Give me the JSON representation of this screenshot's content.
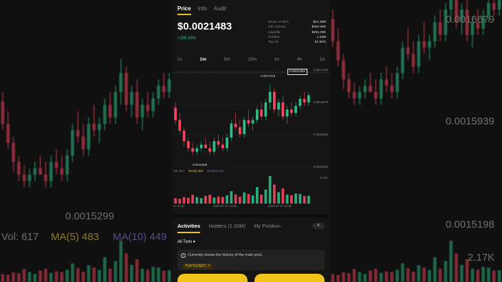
{
  "tabs": [
    "Price",
    "Info",
    "Audit"
  ],
  "price": "$0.0021483",
  "change": "+156.39%",
  "stats": [
    {
      "label": "MCap on BSC",
      "value": "$21.48M"
    },
    {
      "label": "24h Volume",
      "value": "$322.59K"
    },
    {
      "label": "Liquidity",
      "value": "$251.05K"
    },
    {
      "label": "Holders",
      "value": "1.33M"
    },
    {
      "label": "Top 10",
      "value": "51.92%"
    }
  ],
  "timeframes": [
    "1s",
    "1m",
    "5m",
    "15m",
    "1h",
    "4h",
    "1d"
  ],
  "selected_timeframe": "1m",
  "chart": {
    "axis_top": "0.0017403",
    "axis_mid_upper": "0.0016679",
    "axis_mid": "0.0015939",
    "axis_low": "0.0015198",
    "current_price_tag": "0.0021483",
    "high_label": "0.0017319",
    "low_label": "0.0015299",
    "vol_axis": "2.17K",
    "vol_label": "Vol: 617",
    "ma5_label": "MA(5) 483",
    "ma10_label": "MA(10) 449",
    "time_1": "17 10:31",
    "time_2": "2025-07-17 12:36",
    "time_3": "2025-07-17 12:36",
    "colors": {
      "up": "#2ebd85",
      "down": "#f6465d",
      "accent": "#f0c419"
    }
  },
  "chart_data": {
    "type": "candlestick",
    "ohlc": [
      [
        0.001665,
        0.00168,
        0.00162,
        0.00163
      ],
      [
        0.00163,
        0.00165,
        0.00159,
        0.0016
      ],
      [
        0.0016,
        0.00161,
        0.001555,
        0.00157
      ],
      [
        0.00157,
        0.00158,
        0.00154,
        0.00155
      ],
      [
        0.00155,
        0.001565,
        0.00153,
        0.00154
      ],
      [
        0.00154,
        0.00156,
        0.0015299,
        0.00155
      ],
      [
        0.00155,
        0.00157,
        0.00154,
        0.00156
      ],
      [
        0.00156,
        0.00158,
        0.00155,
        0.00155
      ],
      [
        0.00155,
        0.00157,
        0.00153,
        0.00154
      ],
      [
        0.00154,
        0.00158,
        0.00153,
        0.00157
      ],
      [
        0.00157,
        0.00159,
        0.00155,
        0.00156
      ],
      [
        0.00156,
        0.00158,
        0.00154,
        0.00155
      ],
      [
        0.00155,
        0.00159,
        0.00154,
        0.00158
      ],
      [
        0.00158,
        0.00163,
        0.00157,
        0.00162
      ],
      [
        0.00162,
        0.00165,
        0.0016,
        0.00161
      ],
      [
        0.00161,
        0.00163,
        0.00158,
        0.00159
      ],
      [
        0.00159,
        0.00164,
        0.00158,
        0.00163
      ],
      [
        0.00163,
        0.00166,
        0.00161,
        0.00162
      ],
      [
        0.00162,
        0.00164,
        0.0016,
        0.00163
      ],
      [
        0.00163,
        0.00167,
        0.00162,
        0.00166
      ],
      [
        0.00166,
        0.00168,
        0.00163,
        0.00164
      ],
      [
        0.00164,
        0.00169,
        0.00163,
        0.00168
      ],
      [
        0.00168,
        0.0017319,
        0.00166,
        0.00171
      ],
      [
        0.00171,
        0.00172,
        0.00165,
        0.00166
      ],
      [
        0.00166,
        0.00169,
        0.00164,
        0.00168
      ],
      [
        0.00168,
        0.0017,
        0.00163,
        0.00164
      ],
      [
        0.00164,
        0.00167,
        0.00162,
        0.00166
      ],
      [
        0.00166,
        0.00168,
        0.00164,
        0.00165
      ],
      [
        0.00165,
        0.00168,
        0.00164,
        0.00167
      ],
      [
        0.00167,
        0.0017,
        0.00166,
        0.00169
      ],
      [
        0.00169,
        0.00171,
        0.00167,
        0.00168
      ],
      [
        0.00168,
        0.00171,
        0.00167,
        0.0017
      ]
    ],
    "volume": [
      420,
      380,
      510,
      460,
      690,
      520,
      430,
      610,
      700,
      480,
      560,
      520,
      650,
      980,
      720,
      540,
      880,
      760,
      640,
      1300,
      700,
      1100,
      2170,
      1500,
      900,
      1200,
      700,
      650,
      800,
      760,
      600,
      617
    ]
  },
  "activities": {
    "tabs": [
      "Activities",
      "Holders (1.33M)",
      "My Position"
    ],
    "badge": "5",
    "filter": "All Txns",
    "notice": "Currently shows the history of the main pool.",
    "pair": "TUFT/USDT"
  },
  "background": {
    "label_1": "0.0015299",
    "label_2": "Vol: 617",
    "label_3": "MA(5) 483",
    "label_4": "MA(10) 449",
    "label_5": "0.0016679",
    "label_6": "0.0015939",
    "label_7": "0.0015198",
    "label_8": "2.17K"
  }
}
